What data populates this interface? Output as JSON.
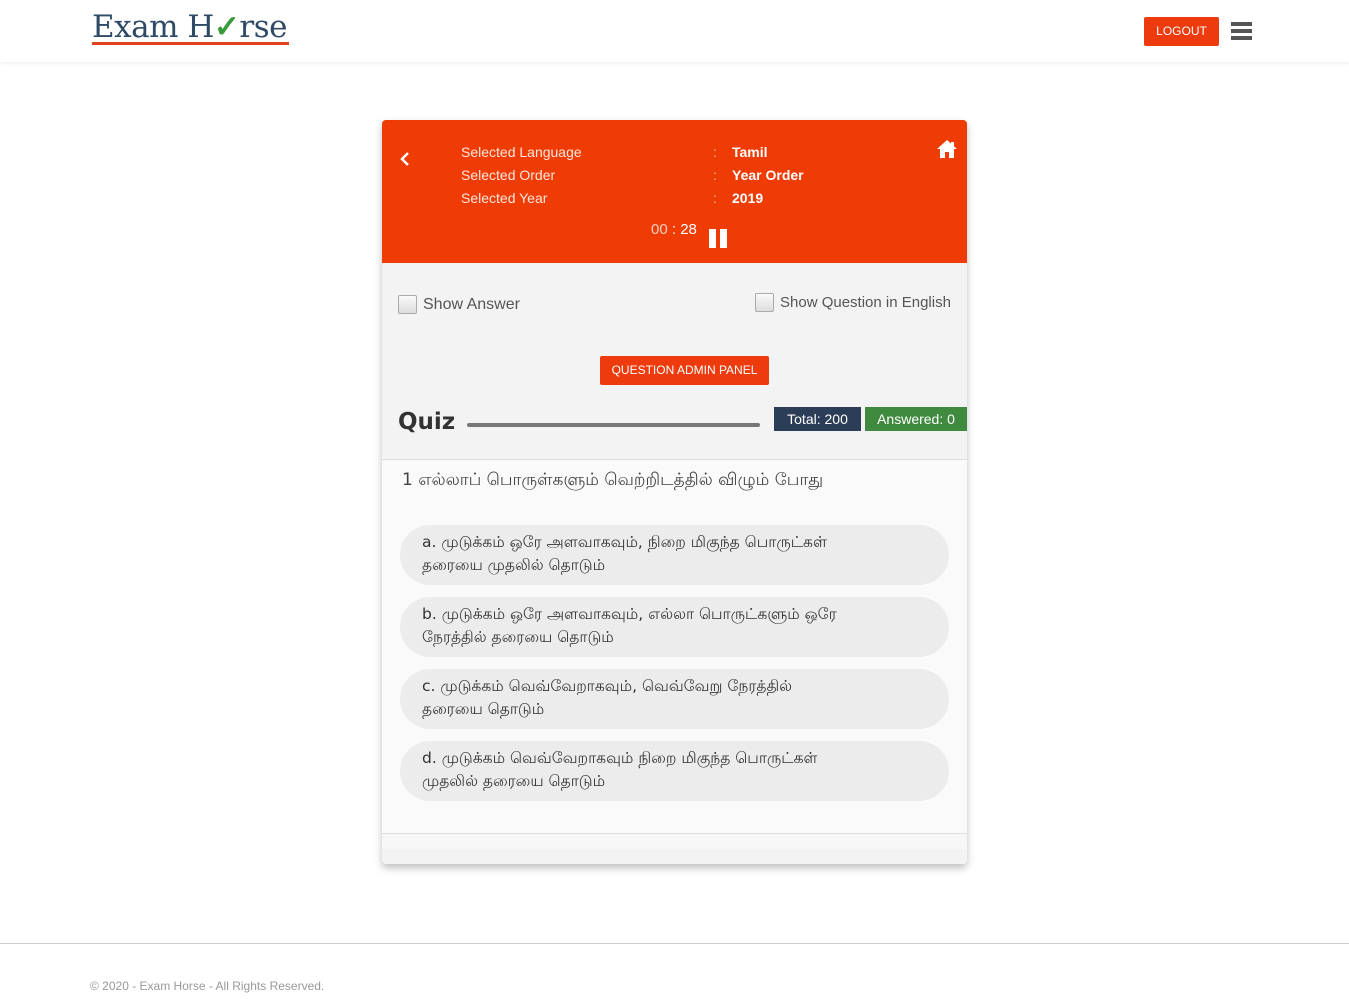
{
  "brand": {
    "logo_pre": "Exam H",
    "logo_check": "✓",
    "logo_post": "rse"
  },
  "header": {
    "logout_label": "LOGOUT"
  },
  "selection": {
    "language_label": "Selected Language",
    "language_value": "Tamil",
    "order_label": "Selected Order",
    "order_value": "Year Order",
    "year_label": "Selected Year",
    "year_value": "2019",
    "colon": ":"
  },
  "timer": {
    "minutes": "00",
    "separator": " : ",
    "seconds": "28"
  },
  "options_bar": {
    "show_answer_label": "Show Answer",
    "show_english_label": "Show Question in English",
    "show_answer_checked": false,
    "show_english_checked": false
  },
  "admin_button_label": "QUESTION ADMIN PANEL",
  "quiz": {
    "title": "Quiz",
    "progress_fraction": 0,
    "total_badge": "Total: 200",
    "answered_badge": "Answered: 0",
    "question": "1 எல்லாப் பொருள்களும் வெற்றிடத்தில் விழும் போது",
    "options": [
      {
        "line1": "a. முடுக்கம் ஒரே அளவாகவும், நிறை மிகுந்த பொருட்கள்",
        "line2": "தரையை முதலில் தொடும்"
      },
      {
        "line1": "b. முடுக்கம் ஒரே அளவாகவும், எல்லா பொருட்களும் ஒரே",
        "line2": "நேரத்தில் தரையை தொடும்"
      },
      {
        "line1": "c. முடுக்கம் வெவ்வேறாகவும், வெவ்வேறு நேரத்தில்",
        "line2": "தரையை தொடும்"
      },
      {
        "line1": "d. முடுக்கம் வெவ்வேறாகவும் நிறை மிகுந்த பொருட்கள்",
        "line2": "முதலில் தரையை தொடும்"
      }
    ]
  },
  "footer": {
    "copyright": "© 2020 - Exam Horse - All Rights Reserved."
  },
  "colors": {
    "accent": "#ef3c05",
    "navy": "#2c3e57",
    "green": "#3f8a3f"
  },
  "icons": {
    "back": "chevron-left-icon",
    "home": "home-icon",
    "pause": "pause-icon",
    "menu": "hamburger-menu-icon"
  }
}
